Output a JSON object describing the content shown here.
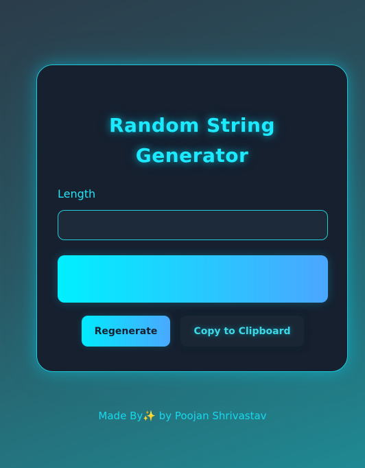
{
  "card": {
    "title": "Random String Generator"
  },
  "length": {
    "label": "Length",
    "value": "",
    "placeholder": ""
  },
  "result": {
    "text": ""
  },
  "buttons": {
    "regenerate_label": "Regenerate",
    "copy_label": "Copy to Clipboard"
  },
  "footer": {
    "text": "Made By✨ by Poojan Shrivastav"
  },
  "colors": {
    "accent": "#1de9ff",
    "card_background": "#16202f",
    "gradient_start": "#00f0ff",
    "gradient_end": "#4ba6ff"
  }
}
